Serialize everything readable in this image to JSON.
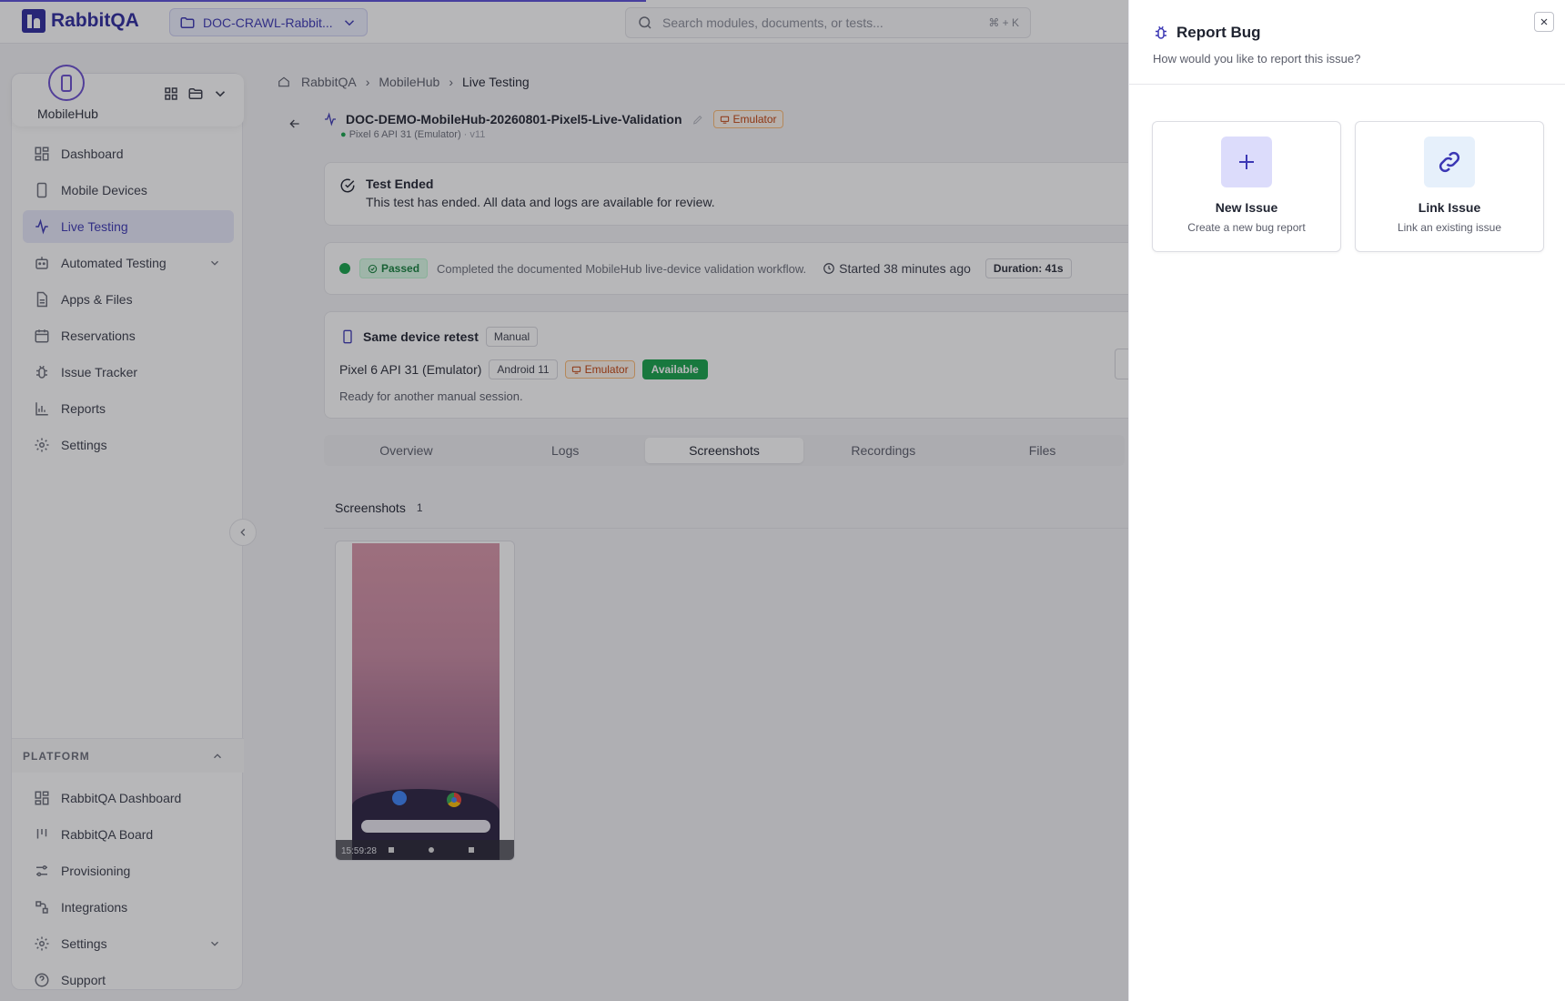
{
  "app": {
    "name": "RabbitQA"
  },
  "topbar": {
    "project": "DOC-CRAWL-Rabbit...",
    "search_placeholder": "Search modules, documents, or tests...",
    "search_shortcut": "⌘ + K"
  },
  "sidebar": {
    "workspace": "MobileHub",
    "items": [
      {
        "label": "Dashboard",
        "icon": "dashboard-icon"
      },
      {
        "label": "Mobile Devices",
        "icon": "mobile-icon"
      },
      {
        "label": "Live Testing",
        "icon": "activity-icon",
        "active": true
      },
      {
        "label": "Automated Testing",
        "icon": "bot-icon",
        "expandable": true
      },
      {
        "label": "Apps & Files",
        "icon": "file-icon"
      },
      {
        "label": "Reservations",
        "icon": "calendar-icon"
      },
      {
        "label": "Issue Tracker",
        "icon": "bug-icon"
      },
      {
        "label": "Reports",
        "icon": "chart-icon"
      },
      {
        "label": "Settings",
        "icon": "gear-icon"
      }
    ],
    "platform_title": "PLATFORM",
    "platform_items": [
      {
        "label": "RabbitQA Dashboard",
        "icon": "dashboard-icon"
      },
      {
        "label": "RabbitQA Board",
        "icon": "board-icon"
      },
      {
        "label": "Provisioning",
        "icon": "sliders-icon"
      },
      {
        "label": "Integrations",
        "icon": "integrations-icon"
      },
      {
        "label": "Settings",
        "icon": "gear-icon",
        "expandable": true
      },
      {
        "label": "Support",
        "icon": "help-icon"
      }
    ]
  },
  "breadcrumb": [
    "RabbitQA",
    "MobileHub",
    "Live Testing"
  ],
  "run": {
    "title": "DOC-DEMO-MobileHub-20260801-Pixel5-Live-Validation",
    "device_line": "Pixel 6 API 31 (Emulator)",
    "version": "· v11",
    "type_badge": "Emulator"
  },
  "ended": {
    "title": "Test Ended",
    "message": "This test has ended. All data and logs are available for review."
  },
  "status": {
    "result": "Passed",
    "summary": "Completed the documented MobileHub live-device validation workflow.",
    "started": "Started 38 minutes ago",
    "duration": "Duration: 41s"
  },
  "retest": {
    "title": "Same device retest",
    "mode": "Manual",
    "device": "Pixel 6 API 31 (Emulator)",
    "os": "Android 11",
    "type": "Emulator",
    "availability": "Available",
    "note": "Ready for another manual session."
  },
  "tabs": [
    {
      "label": "Overview"
    },
    {
      "label": "Logs"
    },
    {
      "label": "Screenshots",
      "active": true
    },
    {
      "label": "Recordings"
    },
    {
      "label": "Files"
    }
  ],
  "screenshots": {
    "label": "Screenshots",
    "count": "1",
    "items": [
      {
        "time": "15:59:28"
      }
    ]
  },
  "drawer": {
    "title": "Report Bug",
    "subtitle": "How would you like to report this issue?",
    "options": [
      {
        "title": "New Issue",
        "desc": "Create a new bug report",
        "icon": "plus-icon"
      },
      {
        "title": "Link Issue",
        "desc": "Link an existing issue",
        "icon": "link-icon"
      }
    ]
  },
  "colors": {
    "accent": "#3b37b4",
    "success": "#16a34a",
    "warning": "#c2410c"
  }
}
